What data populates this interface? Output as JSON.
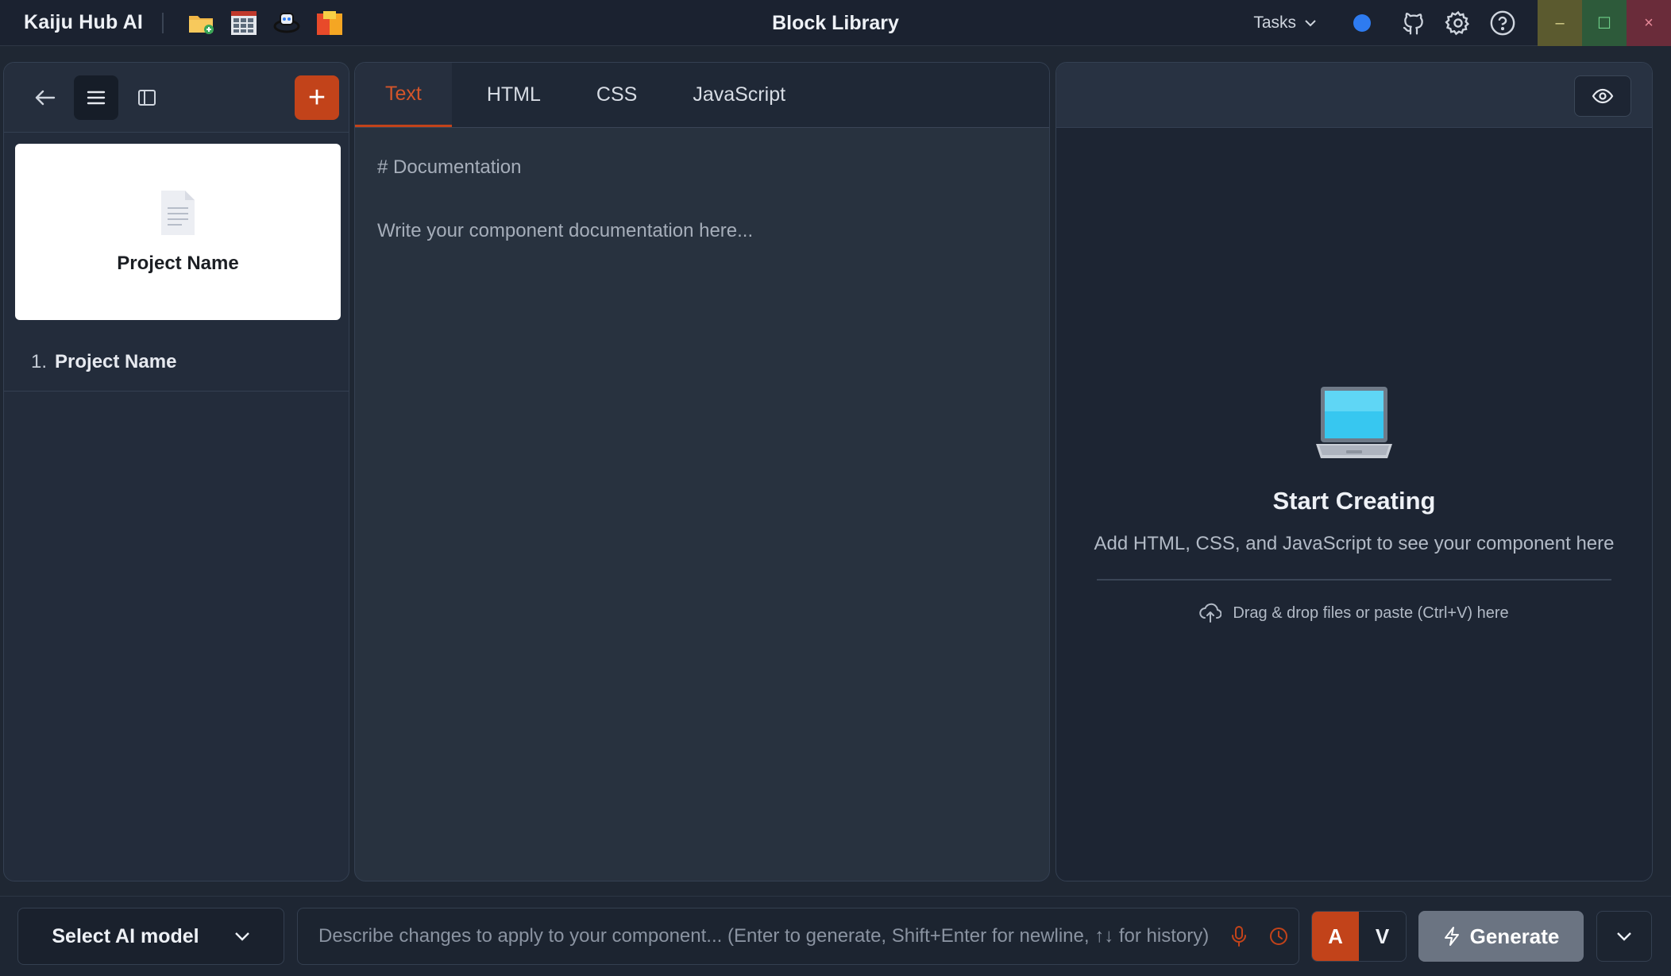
{
  "app": {
    "name": "Kaiju Hub AI",
    "window_title": "Block Library"
  },
  "titlebar": {
    "quick_icons": [
      "folder-add-icon",
      "grid-table-icon",
      "robot-icon",
      "color-blocks-icon"
    ],
    "tasks_label": "Tasks",
    "status_color": "#2e7bf0",
    "icons": [
      "github-icon",
      "gear-icon",
      "help-icon"
    ],
    "window_controls": {
      "minimize": "–",
      "maximize": "☐",
      "close": "×"
    }
  },
  "sidebar": {
    "add_label": "+",
    "card": {
      "title": "Project Name"
    },
    "items": [
      {
        "num": "1.",
        "label": "Project Name"
      }
    ]
  },
  "editor": {
    "tabs": [
      {
        "label": "Text"
      },
      {
        "label": "HTML"
      },
      {
        "label": "CSS"
      },
      {
        "label": "JavaScript"
      }
    ],
    "heading": "# Documentation",
    "body": "Write your component documentation here..."
  },
  "preview": {
    "empty_icon": "laptop-icon",
    "title": "Start Creating",
    "description": "Add HTML, CSS, and JavaScript to see your component here",
    "drop_hint": "Drag & drop files or paste (Ctrl+V) here"
  },
  "bottom": {
    "model_label": "Select AI model",
    "prompt_placeholder": "Describe changes to apply to your component... (Enter to generate, Shift+Enter for newline, ↑↓ for history)",
    "mode_a": "A",
    "mode_v": "V",
    "generate_label": "Generate"
  },
  "colors": {
    "accent": "#c2431a",
    "background": "#1f2733"
  }
}
